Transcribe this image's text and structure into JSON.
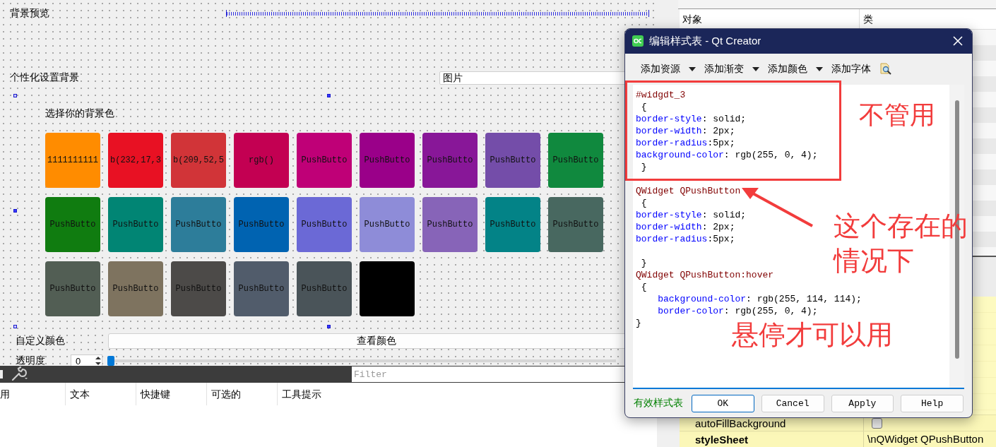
{
  "canvas": {
    "preview_label": "背景预览",
    "personalize_label": "个性化设置背景",
    "background_type": {
      "value": "图片"
    },
    "choose_label": "选择你的背景色",
    "color_buttons": [
      {
        "text": "1111111111",
        "color": "#ff8c00"
      },
      {
        "text": "b(232,17,3",
        "color": "#e81123"
      },
      {
        "text": "b(209,52,5",
        "color": "#d13438"
      },
      {
        "text": "rgb()",
        "color": "#c30052"
      },
      {
        "text": "PushButto",
        "color": "#bf0077"
      },
      {
        "text": "PushButto",
        "color": "#9a0089"
      },
      {
        "text": "PushButto",
        "color": "#881798"
      },
      {
        "text": "PushButto",
        "color": "#744da9"
      },
      {
        "text": "PushButto",
        "color": "#10893e"
      },
      {
        "text": "PushButto",
        "color": "#107c10"
      },
      {
        "text": "PushButto",
        "color": "#018574"
      },
      {
        "text": "PushButto",
        "color": "#2d7d9a"
      },
      {
        "text": "PushButto",
        "color": "#0063b1"
      },
      {
        "text": "PushButto",
        "color": "#6b69d6"
      },
      {
        "text": "PushButto",
        "color": "#8e8cd8"
      },
      {
        "text": "PushButto",
        "color": "#8764b8"
      },
      {
        "text": "PushButto",
        "color": "#038387"
      },
      {
        "text": "PushButto",
        "color": "#486860"
      },
      {
        "text": "PushButto",
        "color": "#525e54"
      },
      {
        "text": "PushButto",
        "color": "#7e735f"
      },
      {
        "text": "PushButto",
        "color": "#4c4a48"
      },
      {
        "text": "PushButto",
        "color": "#515c6b"
      },
      {
        "text": "PushButto",
        "color": "#4a5459"
      },
      {
        "color": "#000000"
      }
    ],
    "custom_color_label": "自定义颜色",
    "view_color_button": "查看颜色",
    "opacity_label": "透明度",
    "opacity_spin": "0",
    "opacity_slider": {
      "level": 0
    }
  },
  "action_editor": {
    "filter": {
      "placeholder": "Filter"
    },
    "columns": [
      "用",
      "文本",
      "快捷键",
      "可选的",
      "工具提示"
    ]
  },
  "object_inspector": {
    "columns": [
      "对象",
      "类"
    ]
  },
  "property_editor": {
    "rows": [
      {
        "name": "autoFillBackground",
        "kind": "checkbox",
        "checked": false,
        "changed": false
      },
      {
        "name": "styleSheet",
        "kind": "text",
        "value": "\\nQWidget QPushButton",
        "changed": true
      }
    ]
  },
  "dialog": {
    "title": "编辑样式表 - Qt Creator",
    "toolbar": [
      {
        "label": "添加资源",
        "kind": "menu"
      },
      {
        "label": "添加渐变",
        "kind": "menu"
      },
      {
        "label": "添加颜色",
        "kind": "menu"
      },
      {
        "label": "添加字体",
        "kind": "plain"
      }
    ],
    "code": [
      {
        "segments": [
          {
            "text": "#widgdt_3",
            "kind": "selector"
          }
        ]
      },
      {
        "segments": [
          {
            "text": " {",
            "kind": "plain"
          }
        ]
      },
      {
        "segments": [
          {
            "text": "border-style",
            "kind": "property"
          },
          {
            "text": ": solid;",
            "kind": "plain"
          }
        ]
      },
      {
        "segments": [
          {
            "text": "border-width",
            "kind": "property"
          },
          {
            "text": ": 2px;",
            "kind": "plain"
          }
        ]
      },
      {
        "segments": [
          {
            "text": "border-radius",
            "kind": "property"
          },
          {
            "text": ":5px;",
            "kind": "plain"
          }
        ]
      },
      {
        "segments": [
          {
            "text": "background-color",
            "kind": "property"
          },
          {
            "text": ": rgb(255, 0, 4);",
            "kind": "plain"
          }
        ]
      },
      {
        "segments": [
          {
            "text": " }",
            "kind": "plain"
          }
        ]
      },
      {
        "blank_before": true,
        "segments": [
          {
            "text": "QWidget QPushButton",
            "kind": "selector"
          }
        ]
      },
      {
        "segments": [
          {
            "text": " {",
            "kind": "plain"
          }
        ]
      },
      {
        "segments": [
          {
            "text": "border-style",
            "kind": "property"
          },
          {
            "text": ": solid;",
            "kind": "plain"
          }
        ]
      },
      {
        "segments": [
          {
            "text": "border-width",
            "kind": "property"
          },
          {
            "text": ": 2px;",
            "kind": "plain"
          }
        ]
      },
      {
        "segments": [
          {
            "text": "border-radius",
            "kind": "property"
          },
          {
            "text": ":5px;",
            "kind": "plain"
          }
        ]
      },
      {
        "blank_before": true,
        "segments": [
          {
            "text": " }",
            "kind": "plain"
          }
        ]
      },
      {
        "segments": [
          {
            "text": "QWidget QPushButton:hover",
            "kind": "selector"
          }
        ]
      },
      {
        "segments": [
          {
            "text": " {",
            "kind": "plain"
          }
        ]
      },
      {
        "segments": [
          {
            "text": "    background-color",
            "kind": "property"
          },
          {
            "text": ": rgb(255, 114, 114);",
            "kind": "plain"
          }
        ]
      },
      {
        "segments": [
          {
            "text": "    border-color",
            "kind": "property"
          },
          {
            "text": ": rgb(255, 0, 4);",
            "kind": "plain"
          }
        ]
      },
      {
        "segments": [
          {
            "text": "}",
            "kind": "plain"
          }
        ]
      }
    ],
    "status": "有效样式表",
    "buttons": [
      {
        "label": "OK",
        "default": true
      },
      {
        "label": "Cancel",
        "default": false
      },
      {
        "label": "Apply",
        "default": false
      },
      {
        "label": "Help",
        "default": false
      }
    ]
  },
  "annotations": [
    {
      "kind": "box"
    },
    {
      "kind": "note",
      "lines": [
        "不管用"
      ]
    },
    {
      "kind": "arrow"
    },
    {
      "kind": "note",
      "lines": [
        "这个存在的",
        "情况下"
      ]
    },
    {
      "kind": "note",
      "lines": [
        "悬停才可以用"
      ]
    }
  ]
}
